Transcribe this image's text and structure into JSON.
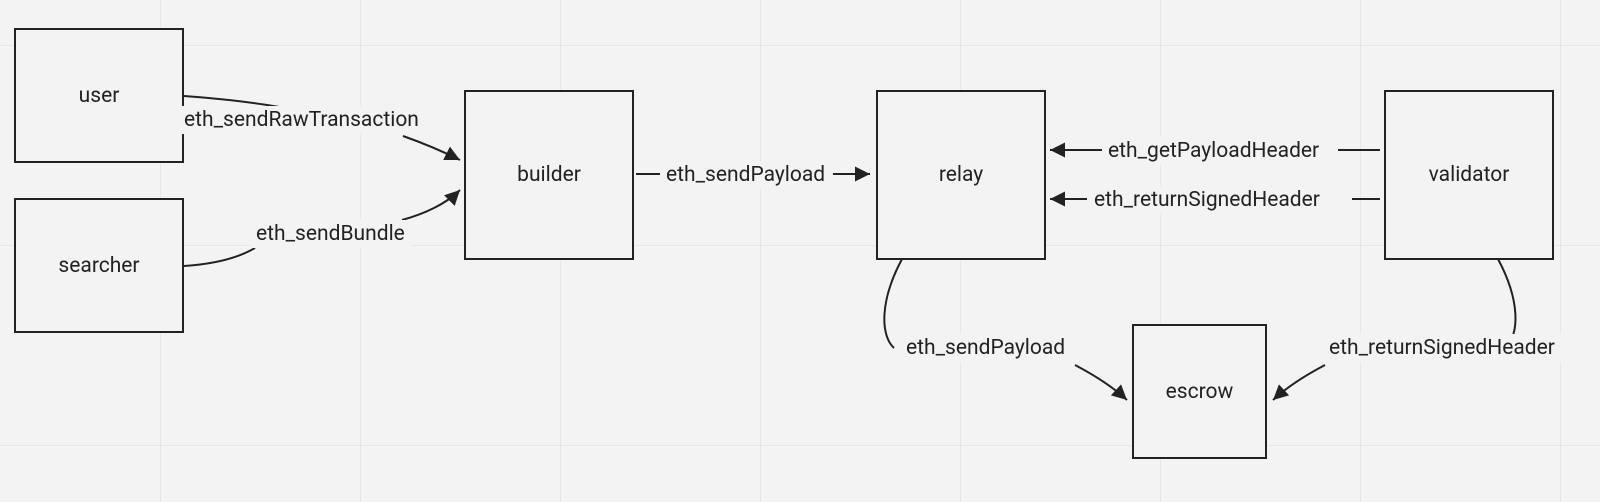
{
  "diagram": {
    "nodes": {
      "user": {
        "label": "user"
      },
      "searcher": {
        "label": "searcher"
      },
      "builder": {
        "label": "builder"
      },
      "relay": {
        "label": "relay"
      },
      "validator": {
        "label": "validator"
      },
      "escrow": {
        "label": "escrow"
      }
    },
    "edges": {
      "user_to_builder": {
        "label": "eth_sendRawTransaction"
      },
      "searcher_to_builder": {
        "label": "eth_sendBundle"
      },
      "builder_to_relay": {
        "label": "eth_sendPayload"
      },
      "validator_to_relay_get": {
        "label": "eth_getPayloadHeader"
      },
      "validator_to_relay_return": {
        "label": "eth_returnSignedHeader"
      },
      "relay_to_escrow": {
        "label": "eth_sendPayload"
      },
      "validator_to_escrow": {
        "label": "eth_returnSignedHeader"
      }
    }
  }
}
